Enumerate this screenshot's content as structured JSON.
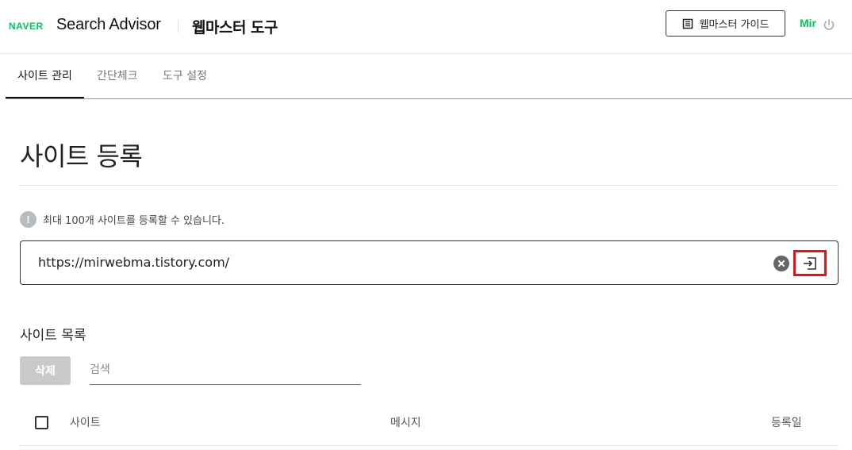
{
  "header": {
    "logo": "NAVER",
    "brand": "Search Advisor",
    "tool_title": "웹마스터 도구",
    "guide_button": "웹마스터 가이드",
    "user": "Mir"
  },
  "tabs": [
    {
      "label": "사이트 관리",
      "active": true
    },
    {
      "label": "간단체크",
      "active": false
    },
    {
      "label": "도구 설정",
      "active": false
    }
  ],
  "register": {
    "title": "사이트 등록",
    "notice": "최대 100개 사이트를 등록할 수 있습니다.",
    "url_value": "https://mirwebma.tistory.com/"
  },
  "site_list": {
    "title": "사이트 목록",
    "delete_button": "삭제",
    "search_placeholder": "검색",
    "columns": [
      "사이트",
      "메시지",
      "등록일"
    ]
  },
  "colors": {
    "brand_green": "#03c75a",
    "highlight_red": "#e11111",
    "disabled_gray": "#c9c9c9"
  }
}
